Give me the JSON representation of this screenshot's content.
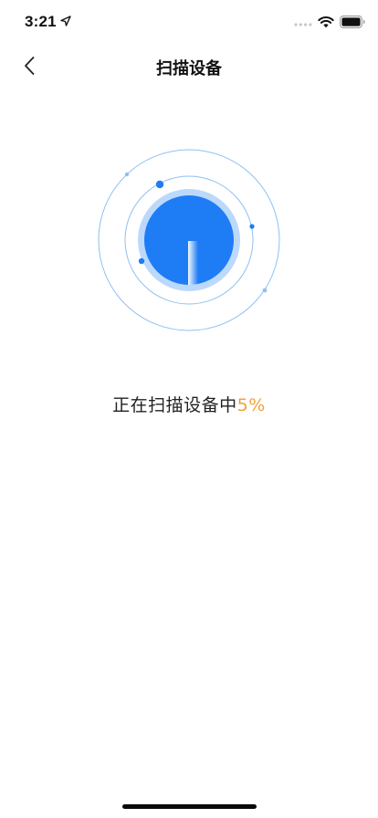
{
  "status_bar": {
    "time": "3:21",
    "icons": [
      "location-arrow-icon",
      "cellular-signal-icon",
      "wifi-icon",
      "battery-icon"
    ]
  },
  "nav": {
    "title": "扫描设备",
    "back_icon": "chevron-left-icon"
  },
  "scan": {
    "status_text": "正在扫描设备中",
    "progress_text": "5%",
    "progress": 0.05
  },
  "colors": {
    "accent": "#1e7cf5",
    "accent_light": "#bcd9fb",
    "ring": "#8ec1f2",
    "percent": "#f0a23a"
  }
}
